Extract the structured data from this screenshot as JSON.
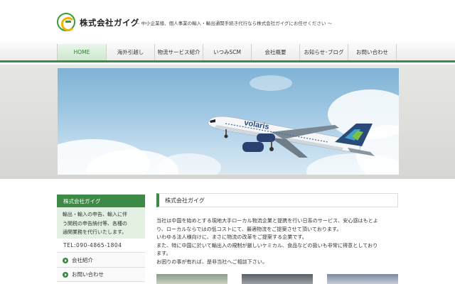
{
  "header": {
    "logo_icon": "company-logo-icon",
    "brand": "株式会社ガイグ",
    "tagline": "～ 中小企業様、個人事業の輸入・輸出通関手続き代行なら株式会社ガイグにお任せください ～"
  },
  "nav": {
    "items": [
      {
        "label": "HOME"
      },
      {
        "label": "海外引越し"
      },
      {
        "label": "物流サービス紹介"
      },
      {
        "label": "いつみSCM"
      },
      {
        "label": "会社概要"
      },
      {
        "label": "お知らせ･ブログ"
      },
      {
        "label": "お問い合わせ"
      }
    ]
  },
  "hero": {
    "airline_text": "volaris"
  },
  "sidebar": {
    "heading": "株式会社ガイグ",
    "description_lines": [
      "輸出・輸入の申告、輸入に伴",
      "う関税の申告納付等、各種の",
      "通関業務を代行いたします。"
    ],
    "tel": "TEL:090-4865-1804",
    "links": [
      {
        "label": "会社紹介"
      },
      {
        "label": "お問い合わせ"
      }
    ]
  },
  "main": {
    "heading": "株式会社ガイグ",
    "paragraphs": [
      "当社は中国を始めとする現地大手ローカル物流企業と提携を行い日系のサービス、安心感はもとよ",
      "り、ローカルならではの低コストにて、最適物流をご提案させて頂いております。",
      "いわゆる法人様向けに、まさに物流の改革をご提案する企業です。",
      "また、特に中国に於いて輸出入の規制が厳しいケミカル、食品などの扱いも非常に得意としており",
      "ます。",
      "お困りの事が有れば、是非当社へご相談下さい。"
    ]
  },
  "colors": {
    "accent_green": "#3c8a46",
    "light_green": "#e3f1e3"
  }
}
